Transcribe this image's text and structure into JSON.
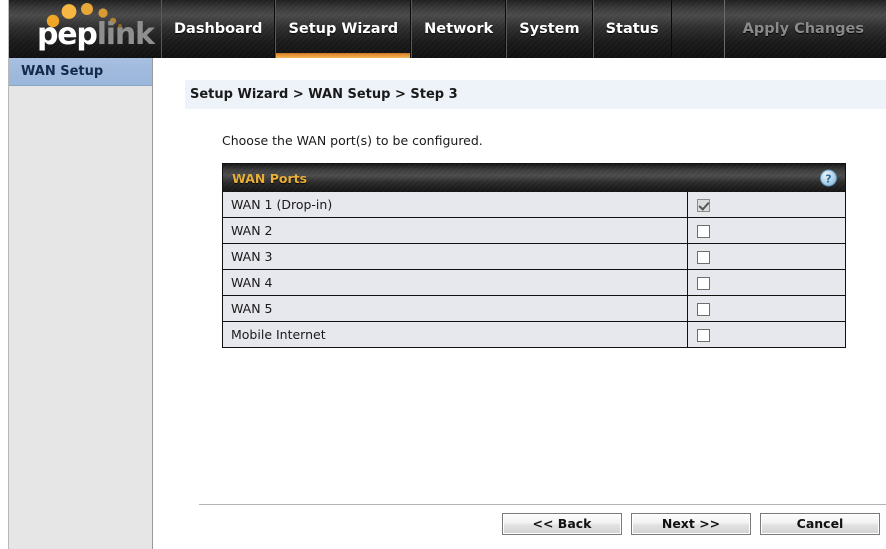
{
  "brand": {
    "logo_primary": "pep",
    "logo_secondary": "link",
    "accent_color": "#e8b03a",
    "dot_color": "#f0a830"
  },
  "topnav": {
    "items": [
      {
        "label": "Dashboard",
        "active": false
      },
      {
        "label": "Setup Wizard",
        "active": true
      },
      {
        "label": "Network",
        "active": false
      },
      {
        "label": "System",
        "active": false
      },
      {
        "label": "Status",
        "active": false
      }
    ],
    "apply_changes_label": "Apply Changes",
    "apply_changes_enabled": false
  },
  "sidebar": {
    "items": [
      {
        "label": "WAN Setup",
        "selected": true
      }
    ]
  },
  "main": {
    "breadcrumb": "Setup Wizard > WAN Setup > Step 3",
    "instruction": "Choose the WAN port(s) to be configured.",
    "panel": {
      "title": "WAN Ports",
      "help_icon": "question-mark",
      "rows": [
        {
          "name": "WAN 1 (Drop-in)",
          "checked": true,
          "disabled": true
        },
        {
          "name": "WAN 2",
          "checked": false,
          "disabled": false
        },
        {
          "name": "WAN 3",
          "checked": false,
          "disabled": false
        },
        {
          "name": "WAN 4",
          "checked": false,
          "disabled": false
        },
        {
          "name": "WAN 5",
          "checked": false,
          "disabled": false
        },
        {
          "name": "Mobile Internet",
          "checked": false,
          "disabled": false
        }
      ]
    }
  },
  "footer": {
    "buttons": [
      {
        "label": "<< Back",
        "name": "back-button"
      },
      {
        "label": "Next >>",
        "name": "next-button"
      },
      {
        "label": "Cancel",
        "name": "cancel-button"
      }
    ]
  }
}
